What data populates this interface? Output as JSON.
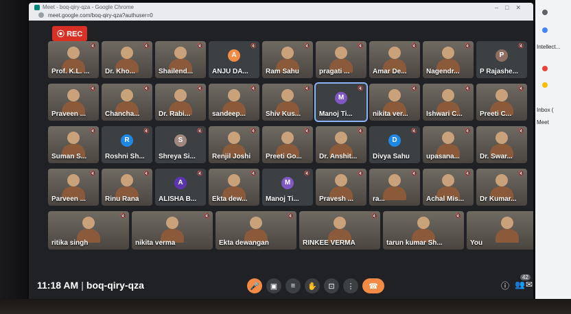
{
  "browser": {
    "title": "Meet - boq-qiry-qza - Google Chrome",
    "url": "meet.google.com/boq-qiry-qza?authuser=0"
  },
  "rec_label": "REC",
  "meeting_code": "boq-qiry-qza",
  "time": "11:18 AM",
  "participant_count": "42",
  "participants": [
    {
      "name": "Prof. K.L. ...",
      "photo": true
    },
    {
      "name": "Dr. Kho...",
      "photo": true
    },
    {
      "name": "Shailend...",
      "photo": true
    },
    {
      "name": "ANJU DA...",
      "avatar": "A",
      "color": "#f28b45"
    },
    {
      "name": "Ram Sahu",
      "photo": true
    },
    {
      "name": "pragati ...",
      "photo": true
    },
    {
      "name": "Amar De...",
      "photo": true
    },
    {
      "name": "Nagendr...",
      "photo": true
    },
    {
      "name": "P Rajashe...",
      "avatar": "P",
      "color": "#8d6e63"
    },
    {
      "name": "Praveen ...",
      "photo": true
    },
    {
      "name": "Chancha...",
      "photo": true
    },
    {
      "name": "Dr. Rabi...",
      "photo": true
    },
    {
      "name": "sandeep...",
      "photo": true
    },
    {
      "name": "Shiv Kus...",
      "photo": true
    },
    {
      "name": "Manoj Ti...",
      "avatar": "M",
      "color": "#7e57c2",
      "active": true
    },
    {
      "name": "nikita ver...",
      "photo": true
    },
    {
      "name": "Ishwari C...",
      "photo": true
    },
    {
      "name": "Preeti C...",
      "photo": true
    },
    {
      "name": "Suman S...",
      "photo": true
    },
    {
      "name": "Roshni Sh...",
      "avatar": "R",
      "color": "#1e88e5"
    },
    {
      "name": "Shreya Si...",
      "avatar": "S",
      "color": "#a1887f"
    },
    {
      "name": "Renjil Joshi",
      "photo": true
    },
    {
      "name": "Preeti Go...",
      "photo": true
    },
    {
      "name": "Dr. Anshit...",
      "photo": true
    },
    {
      "name": "Divya Sahu",
      "avatar": "D",
      "color": "#1e88e5"
    },
    {
      "name": "upasana...",
      "photo": true
    },
    {
      "name": "Dr. Swar...",
      "photo": true
    },
    {
      "name": "Parveen ...",
      "photo": true
    },
    {
      "name": "Rinu Rana",
      "photo": true
    },
    {
      "name": "ALISHA B...",
      "avatar": "A",
      "color": "#5e35b1"
    },
    {
      "name": "Ekta dew...",
      "photo": true
    },
    {
      "name": "Manoj Ti...",
      "avatar": "M",
      "color": "#7e57c2"
    },
    {
      "name": "Pravesh ...",
      "photo": true
    },
    {
      "name": "ra...",
      "photo": true
    },
    {
      "name": "Achal Mis...",
      "photo": true
    },
    {
      "name": "Dr Kumar...",
      "photo": true
    },
    {
      "name": "ritika singh",
      "photo": true
    },
    {
      "name": "nikita verma",
      "photo": true
    },
    {
      "name": "Ekta dewangan",
      "photo": true
    },
    {
      "name": "RINKEE VERMA",
      "photo": true
    },
    {
      "name": "tarun kumar Sh...",
      "photo": true
    },
    {
      "name": "You",
      "photo": true
    }
  ],
  "sidebar": [
    "Intellect...",
    "Inbox (",
    "Meet"
  ]
}
